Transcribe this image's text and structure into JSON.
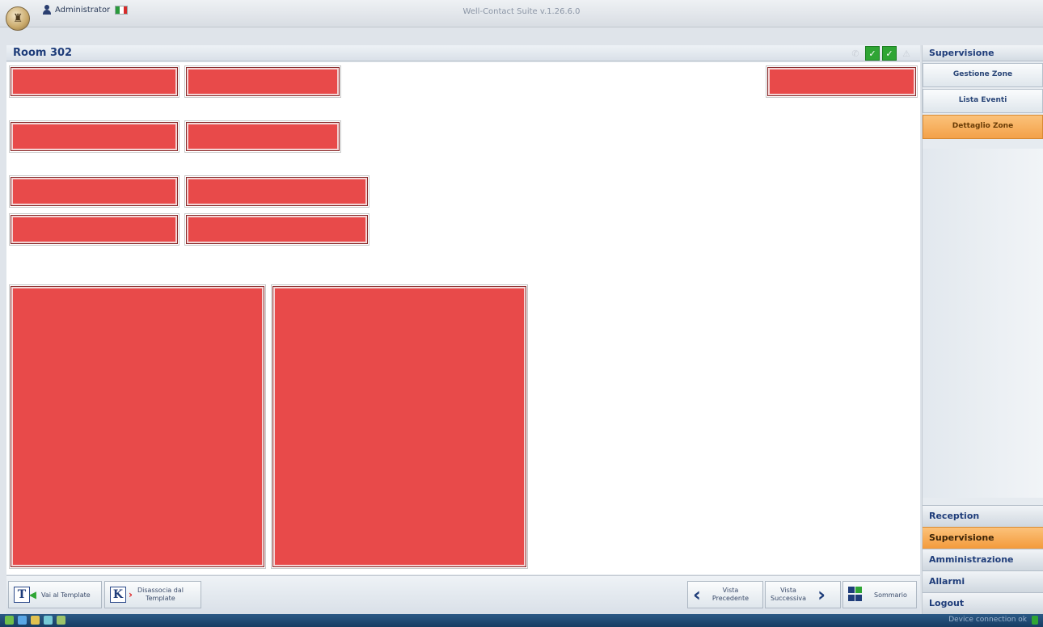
{
  "app": {
    "title": "Well-Contact Suite v.1.26.6.0"
  },
  "user": {
    "name": "Administrator",
    "language_flag": "italian-flag",
    "flag_colors": [
      "#2a9a3c",
      "#ffffff",
      "#d62b2b"
    ]
  },
  "header": {
    "room_title": "Room 302"
  },
  "status_icons": [
    {
      "name": "phone-icon",
      "glyph": "✆",
      "state": "inactive"
    },
    {
      "name": "check-icon",
      "glyph": "✓",
      "state": "ok"
    },
    {
      "name": "check-icon",
      "glyph": "✓",
      "state": "ok"
    },
    {
      "name": "alarm-icon",
      "glyph": "⚠",
      "state": "inactive"
    }
  ],
  "zones": {
    "count": 11,
    "color": "#e84a4a"
  },
  "right_panel": {
    "header": "Supervisione",
    "buttons": [
      {
        "label": "Gestione Zone",
        "active": false
      },
      {
        "label": "Lista Eventi",
        "active": false
      },
      {
        "label": "Dettaglio Zone",
        "active": true
      }
    ]
  },
  "nav_sections": [
    {
      "label": "Reception",
      "active": false
    },
    {
      "label": "Supervisione",
      "active": true
    },
    {
      "label": "Amministrazione",
      "active": false
    },
    {
      "label": "Allarmi",
      "active": false
    },
    {
      "label": "Logout",
      "active": false
    }
  ],
  "toolbar": {
    "goto_template": "Vai al Template",
    "dissociate_template_line1": "Disassocia dal",
    "dissociate_template_line2": "Template",
    "prev_view_line1": "Vista",
    "prev_view_line2": "Precedente",
    "next_view_line1": "Vista",
    "next_view_line2": "Successiva",
    "summary": "Sommario"
  },
  "statusbar": {
    "connection": "Device connection ok"
  },
  "colors": {
    "accent_orange": "#f3a149",
    "title_blue": "#1f3d7a",
    "ok_green": "#2fa534",
    "zone_red": "#e84a4a"
  }
}
